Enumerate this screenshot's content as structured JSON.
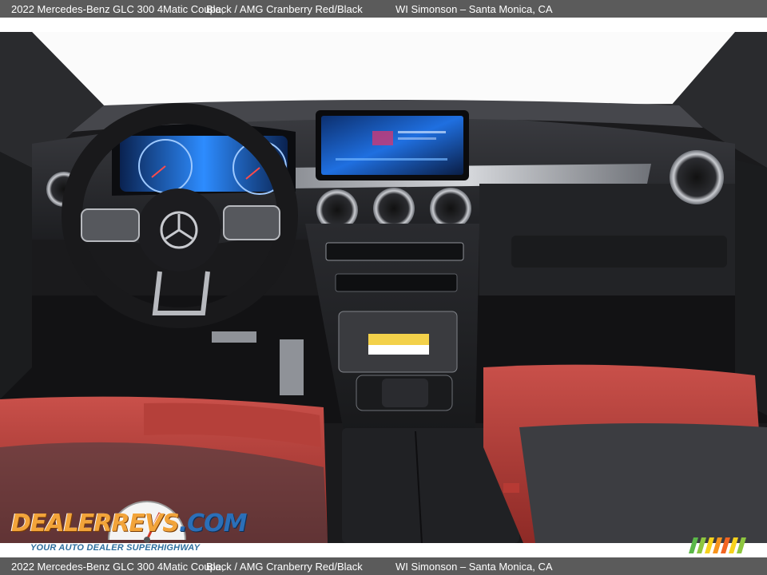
{
  "caption": {
    "title": "2022 Mercedes-Benz GLC 300 4Matic Coupe,",
    "colors": "Black / AMG Cranberry Red/Black",
    "dealer": "WI Simonson – Santa Monica, CA"
  },
  "watermark": {
    "brand_part1": "DEALER",
    "brand_part2": "REVS",
    "brand_part3": ".COM",
    "tagline": "YOUR AUTO DEALER SUPERHIGHWAY",
    "colors": {
      "orange": "#f2a43a",
      "blue": "#2b6fb8",
      "tagline": "#2e6f9e"
    }
  },
  "photo": {
    "subject": "interior-dashboard",
    "colors": {
      "seat_red": "#b73a34",
      "dash_black": "#1b1b1e",
      "screen_blue": "#1f6fe0"
    }
  },
  "colors": {
    "caption_bar": "#5b5b5b",
    "caption_text": "#ffffff"
  }
}
